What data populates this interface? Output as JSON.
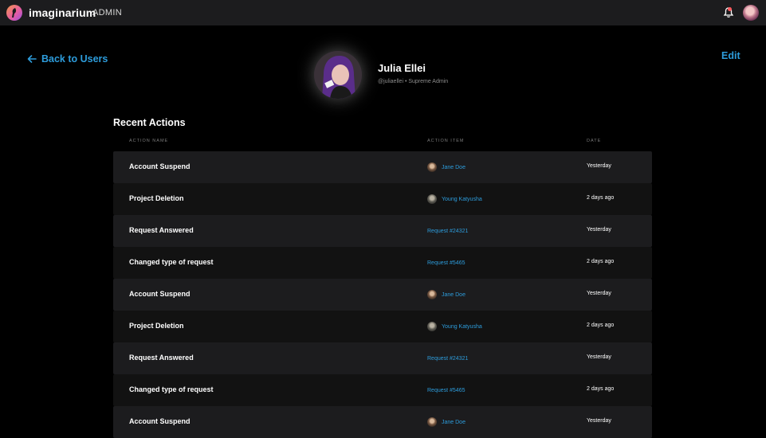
{
  "header": {
    "brand": "imaginarium",
    "section": "ADMIN",
    "notification_icon": "bell-icon",
    "logo_icon": "imaginarium-logo-icon"
  },
  "nav": {
    "back_label": "Back to Users",
    "edit_label": "Edit"
  },
  "profile": {
    "name": "Julia Ellei",
    "meta": "@juliaellei • Supreme Admin"
  },
  "recent_actions": {
    "title": "Recent Actions",
    "columns": [
      "ACTION NAME",
      "ACTION ITEM",
      "DATE"
    ],
    "rows": [
      {
        "name": "Account Suspend",
        "item": "Jane Doe",
        "avatar": "jane",
        "date": "Yesterday"
      },
      {
        "name": "Project Deletion",
        "item": "Young Katyusha",
        "avatar": "young",
        "date": "2 days ago"
      },
      {
        "name": "Request Answered",
        "item": "Request #24321",
        "avatar": "",
        "date": "Yesterday"
      },
      {
        "name": "Changed type of request",
        "item": "Request #5465",
        "avatar": "",
        "date": "2 days ago"
      },
      {
        "name": "Account Suspend",
        "item": "Jane Doe",
        "avatar": "jane",
        "date": "Yesterday"
      },
      {
        "name": "Project Deletion",
        "item": "Young Katyusha",
        "avatar": "young",
        "date": "2 days ago"
      },
      {
        "name": "Request Answered",
        "item": "Request #24321",
        "avatar": "",
        "date": "Yesterday"
      },
      {
        "name": "Changed type of request",
        "item": "Request #5465",
        "avatar": "",
        "date": "2 days ago"
      },
      {
        "name": "Account Suspend",
        "item": "Jane Doe",
        "avatar": "jane",
        "date": "Yesterday"
      }
    ]
  },
  "colors": {
    "accent": "#2d9cdb",
    "background": "#000000",
    "topbar": "#1c1c1e",
    "row_odd": "#1c1c1e",
    "row_even": "#121212"
  }
}
